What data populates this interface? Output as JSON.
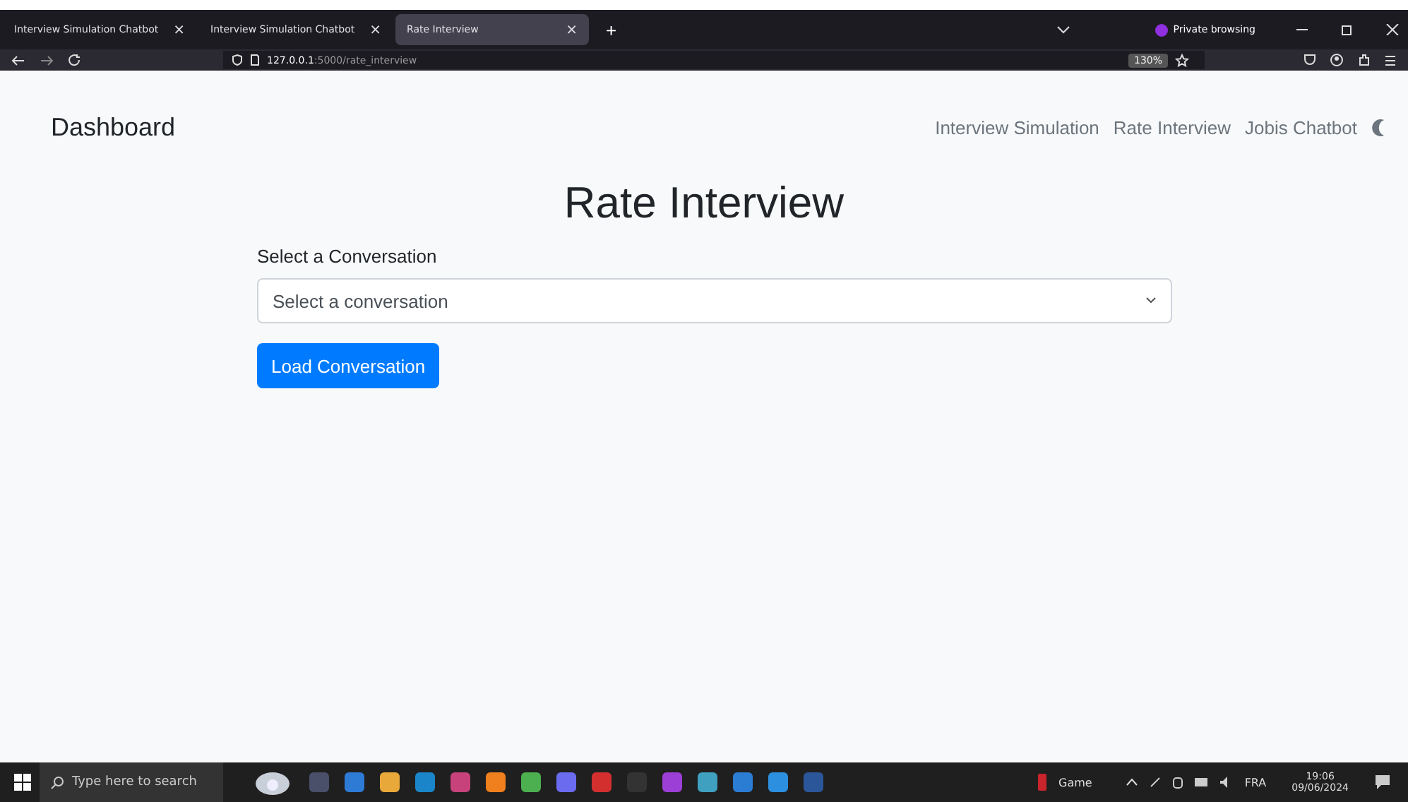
{
  "browser": {
    "tabs": [
      {
        "label": "Interview Simulation Chatbot",
        "selected": false,
        "close": "×"
      },
      {
        "label": "Interview Simulation Chatbot",
        "selected": false,
        "close": "×"
      },
      {
        "label": "Rate Interview",
        "selected": true,
        "close": "×"
      }
    ],
    "new_tab": "+",
    "private_label": "Private browsing",
    "url_host": "127.0.0.1",
    "url_rest": ":5000/rate_interview",
    "zoom": "130%"
  },
  "navbar": {
    "brand": "Dashboard",
    "links": [
      {
        "label": "Interview Simulation"
      },
      {
        "label": "Rate Interview"
      },
      {
        "label": "Jobis Chatbot"
      }
    ]
  },
  "page": {
    "title": "Rate Interview",
    "select_label": "Select a Conversation",
    "select_value": "Select a conversation",
    "button": "Load Conversation"
  },
  "taskbar": {
    "search_placeholder": "Type here to search",
    "game": "Game",
    "lang": "FRA",
    "time": "19:06",
    "date": "09/06/2024"
  }
}
